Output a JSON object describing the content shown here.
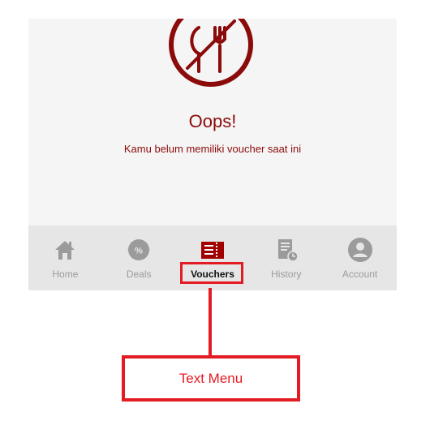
{
  "empty_state": {
    "title": "Oops!",
    "message": "Kamu belum memiliki voucher saat ini",
    "illustration_icon": "no-food-icon"
  },
  "bottom_nav": {
    "active_item": "Vouchers",
    "items": [
      {
        "label": "Home",
        "icon": "home-icon",
        "active": false
      },
      {
        "label": "Deals",
        "icon": "deals-badge-icon",
        "active": false
      },
      {
        "label": "Vouchers",
        "icon": "voucher-ticket-icon",
        "active": true
      },
      {
        "label": "History",
        "icon": "history-document-icon",
        "active": false
      },
      {
        "label": "Account",
        "icon": "account-user-icon",
        "active": false
      }
    ]
  },
  "annotation": {
    "callout_label": "Text Menu"
  },
  "colors": {
    "brand_dark_red": "#8b0a0a",
    "annotation_red": "#e31b23",
    "nav_inactive": "#9b9b9b",
    "nav_background": "#e6e6e6",
    "screen_background": "#f5f5f5"
  }
}
